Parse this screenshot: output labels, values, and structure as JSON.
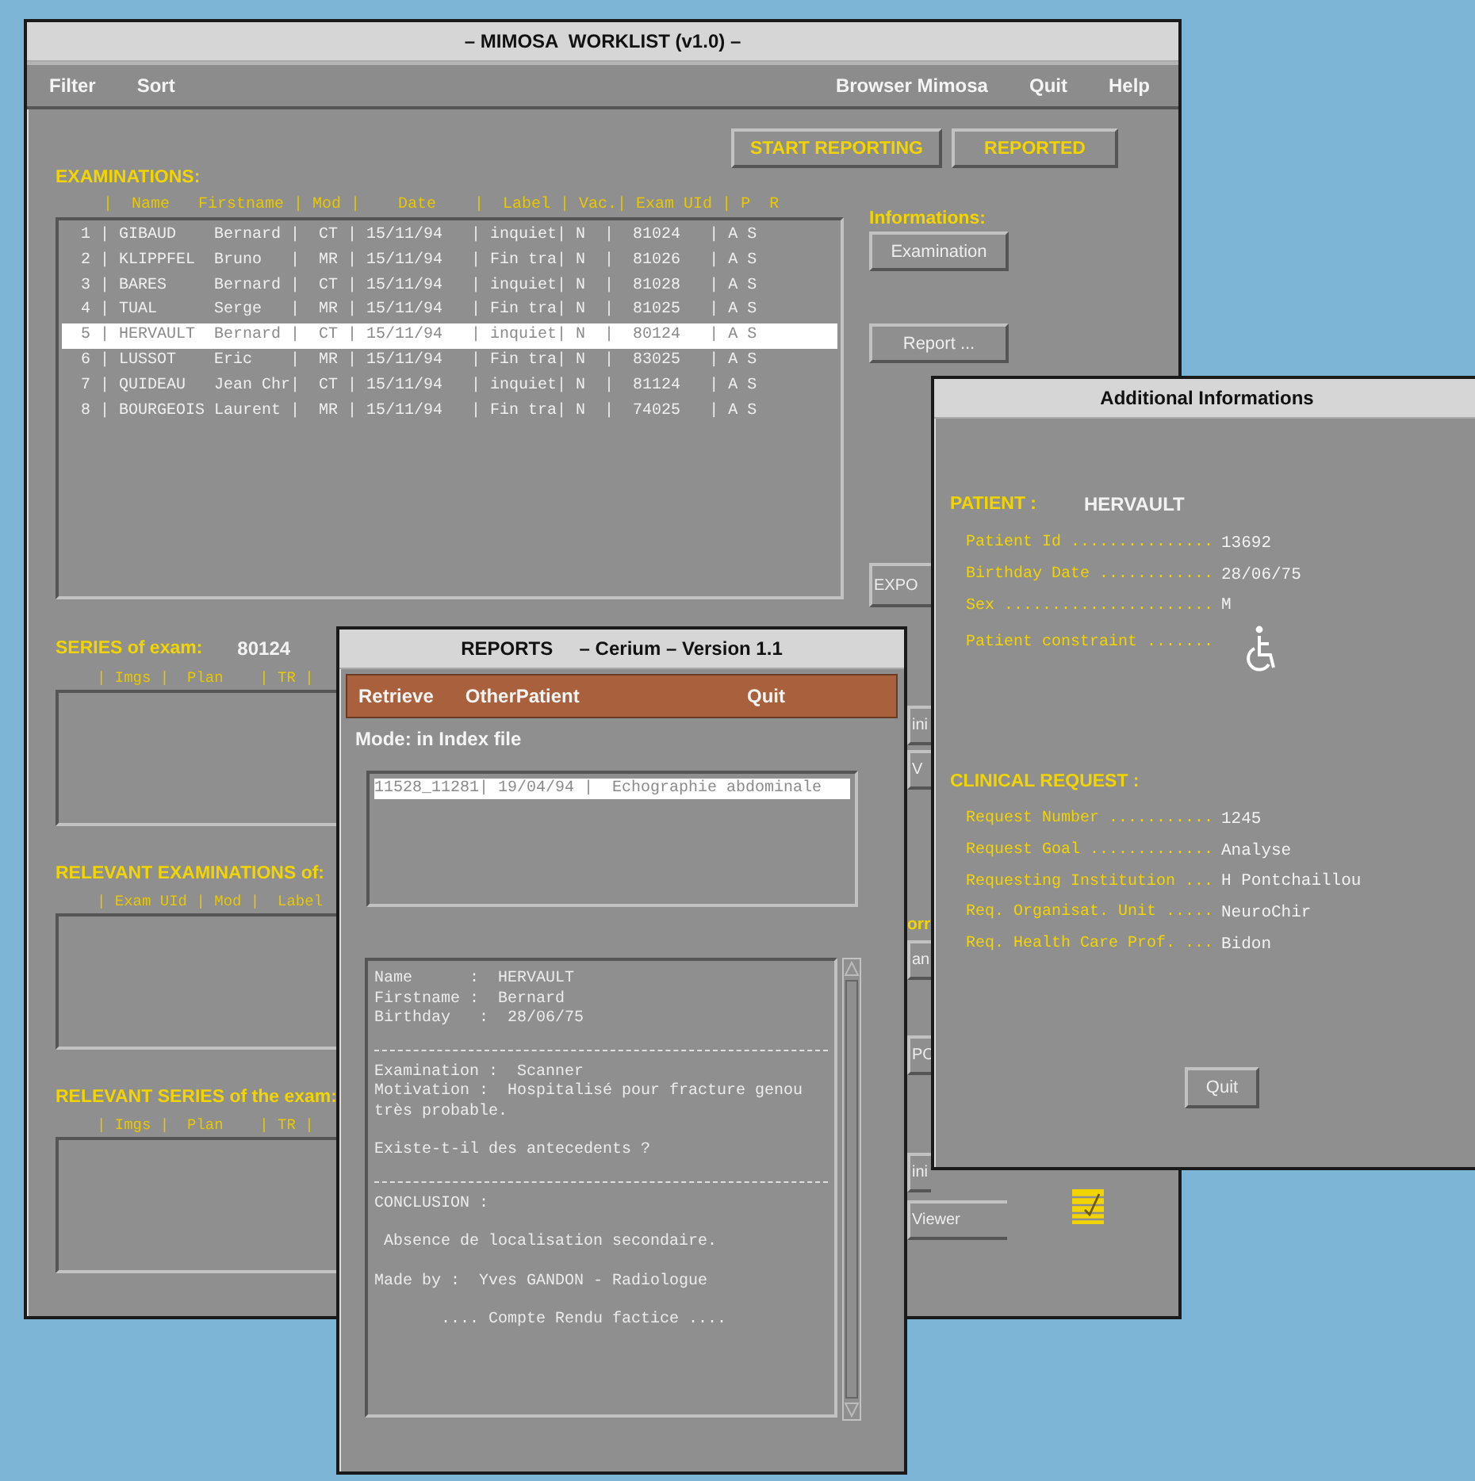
{
  "main_window": {
    "title": "– MIMOSA  WORKLIST (v1.0) –",
    "menu_left": [
      "Filter",
      "Sort"
    ],
    "menu_right": [
      "Browser Mimosa",
      "Quit",
      "Help"
    ],
    "toolbar": [
      "START REPORTING",
      "REPORTED"
    ],
    "examinations": {
      "title": "EXAMINATIONS:",
      "header": "|  Name   Firstname | Mod |    Date    |  Label | Vac.| Exam UId | P  R",
      "rows": [
        {
          "text": "1 | GIBAUD    Bernard |  CT | 15/11/94   | inquiet| N  |  81024   | A S",
          "selected": false
        },
        {
          "text": "2 | KLIPPFEL  Bruno   |  MR | 15/11/94   | Fin tra| N  |  81026   | A S",
          "selected": false
        },
        {
          "text": "3 | BARES     Bernard |  CT | 15/11/94   | inquiet| N  |  81028   | A S",
          "selected": false
        },
        {
          "text": "4 | TUAL      Serge   |  MR | 15/11/94   | Fin tra| N  |  81025   | A S",
          "selected": false
        },
        {
          "text": "5 | HERVAULT  Bernard |  CT | 15/11/94   | inquiet| N  |  80124   | A S",
          "selected": true
        },
        {
          "text": "6 | LUSSOT    Eric    |  MR | 15/11/94   | Fin tra| N  |  83025   | A S",
          "selected": false
        },
        {
          "text": "7 | QUIDEAU   Jean Chr|  CT | 15/11/94   | inquiet| N  |  81124   | A S",
          "selected": false
        },
        {
          "text": "8 | BOURGEOIS Laurent |  MR | 15/11/94   | Fin tra| N  |  74025   | A S",
          "selected": false
        }
      ]
    },
    "informations": {
      "title": "Informations:",
      "buttons": [
        "Examination",
        "Report ..."
      ]
    },
    "sections": [
      {
        "title": "SERIES of exam:",
        "value": "80124",
        "header": "| Imgs |  Plan    | TR |"
      },
      {
        "title": "RELEVANT EXAMINATIONS of:",
        "header": "| Exam UId | Mod |  Label"
      },
      {
        "title": "RELEVANT SERIES of the exam:",
        "header": "| Imgs |  Plan    | TR |"
      }
    ],
    "partly_hidden": [
      {
        "kind": "button",
        "text": "EXPO"
      },
      {
        "kind": "button",
        "text": "ini"
      },
      {
        "kind": "button",
        "text": "V"
      },
      {
        "kind": "label",
        "text": "orr"
      },
      {
        "kind": "button",
        "text": "an"
      },
      {
        "kind": "button",
        "text": "PO"
      },
      {
        "kind": "button",
        "text": "ini"
      },
      {
        "kind": "button",
        "text": "Viewer"
      }
    ]
  },
  "reports_window": {
    "title": "REPORTS     – Cerium – Version 1.1",
    "menu_left": [
      "Retrieve",
      "OtherPatient"
    ],
    "menu_right": [
      "Quit"
    ],
    "mode": "Mode: in Index file",
    "index_rows": [
      {
        "text": "11528_11281| 19/04/94 |  Echographie abdominale",
        "selected": true
      }
    ],
    "report": [
      {
        "kind": "text",
        "lines": [
          "Name      :  HERVAULT",
          "Firstname :  Bernard",
          "Birthday   :  28/06/75"
        ]
      },
      {
        "kind": "rule"
      },
      {
        "kind": "text",
        "lines": [
          "Examination :  Scanner",
          "Motivation :  Hospitalisé pour fracture genou",
          "très probable."
        ]
      },
      {
        "kind": "text",
        "lines": [
          "Existe-t-il des antecedents ?"
        ]
      },
      {
        "kind": "rule"
      },
      {
        "kind": "text",
        "lines": [
          "CONCLUSION :"
        ]
      },
      {
        "kind": "text",
        "lines": [
          " Absence de localisation secondaire."
        ]
      },
      {
        "kind": "text",
        "lines": [
          "Made by :  Yves GANDON - Radiologue"
        ]
      },
      {
        "kind": "text",
        "lines": [
          "       .... Compte Rendu factice ...."
        ]
      }
    ]
  },
  "info_window": {
    "title": "Additional Informations",
    "patient": {
      "title": "PATIENT :",
      "name": "HERVAULT",
      "fields": [
        {
          "label": "Patient Id ...............",
          "value": "13692"
        },
        {
          "label": "Birthday Date ............",
          "value": "28/06/75"
        },
        {
          "label": "Sex ......................",
          "value": "M"
        }
      ],
      "constraint_label": "Patient constraint .......",
      "wheelchair": true
    },
    "request": {
      "title": "CLINICAL REQUEST :",
      "fields": [
        {
          "label": "Request Number ...........",
          "value": "1245"
        },
        {
          "label": "Request Goal .............",
          "value": "Analyse"
        },
        {
          "label": "Requesting Institution ...",
          "value": "H Pontchaillou"
        },
        {
          "label": "Req. Organisat. Unit .....",
          "value": "NeuroChir"
        },
        {
          "label": "Req. Health Care Prof. ...",
          "value": "Bidon"
        }
      ]
    },
    "buttons": [
      "Quit"
    ]
  }
}
